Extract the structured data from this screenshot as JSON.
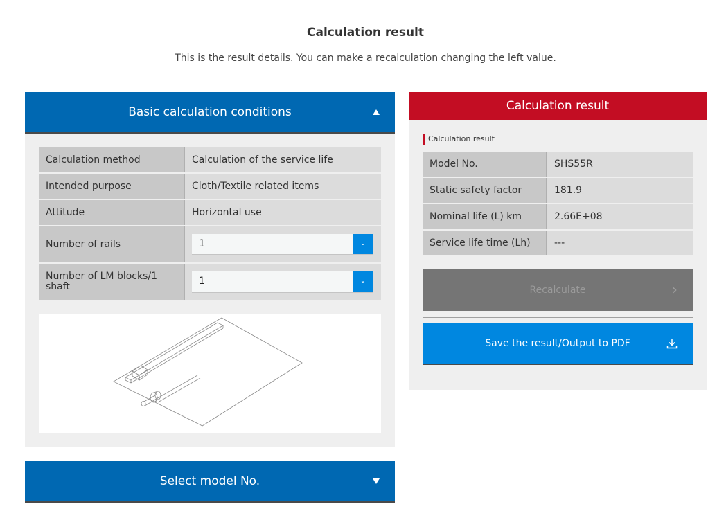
{
  "page": {
    "title": "Calculation result",
    "subtitle": "This is the result details. You can make a recalculation changing the left value."
  },
  "conditions": {
    "header": "Basic calculation conditions",
    "rows": [
      {
        "label": "Calculation method",
        "value": "Calculation of the service life"
      },
      {
        "label": "Intended purpose",
        "value": "Cloth/Textile related items"
      },
      {
        "label": "Attitude",
        "value": "Horizontal use"
      }
    ],
    "selects": [
      {
        "label": "Number of rails",
        "value": "1"
      },
      {
        "label": "Number of LM blocks/1 shaft",
        "value": "1"
      }
    ],
    "dropdown_icon": "chevron-down-icon"
  },
  "select_model": {
    "header": "Select model No."
  },
  "result": {
    "header": "Calculation result",
    "section_label": "Calculation result",
    "rows": [
      {
        "label": "Model No.",
        "value": "SHS55R"
      },
      {
        "label": "Static safety factor",
        "value": "181.9"
      },
      {
        "label": "Nominal life (L) km",
        "value": "2.66E+08"
      },
      {
        "label": "Service life time (Lh)",
        "value": "---"
      }
    ],
    "recalculate_label": "Recalculate",
    "save_label": "Save the result/Output to PDF"
  },
  "colors": {
    "accordion_blue": "#0068b2",
    "button_blue": "#0087e0",
    "result_red": "#c30d23",
    "disabled_gray": "#757575"
  }
}
